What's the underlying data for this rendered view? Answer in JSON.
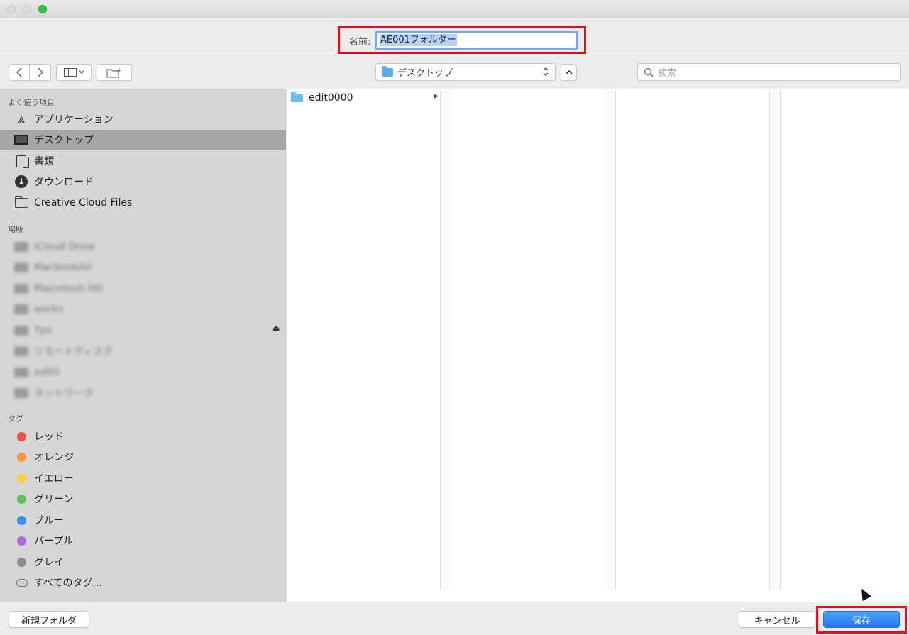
{
  "window": {
    "traffic_lights": [
      "close",
      "minimize",
      "zoom"
    ]
  },
  "name_row": {
    "label": "名前:",
    "value": "AE001フォルダー"
  },
  "toolbar": {
    "back_icon": "chevron-left-icon",
    "forward_icon": "chevron-right-icon",
    "view_icon": "column-view-icon",
    "new_folder_icon": "new-folder-icon",
    "location": "デスクトップ",
    "search_placeholder": "検索"
  },
  "sidebar": {
    "favorites_header": "よく使う項目",
    "favorites": [
      {
        "label": "アプリケーション",
        "icon": "applications-icon"
      },
      {
        "label": "デスクトップ",
        "icon": "desktop-icon",
        "selected": true
      },
      {
        "label": "書類",
        "icon": "documents-icon"
      },
      {
        "label": "ダウンロード",
        "icon": "downloads-icon"
      },
      {
        "label": "Creative Cloud Files",
        "icon": "folder-icon"
      }
    ],
    "locations_header": "場所",
    "locations": [
      {
        "label": "iCloud Drive"
      },
      {
        "label": "MacbookAir"
      },
      {
        "label": "Macintosh HD"
      },
      {
        "label": "works"
      },
      {
        "label": "Tps",
        "eject": true
      },
      {
        "label": "リモートディスク"
      },
      {
        "label": "edit0"
      },
      {
        "label": "ネットワーク"
      }
    ],
    "tags_header": "タグ",
    "tags": [
      {
        "label": "レッド",
        "color": "#f0504a"
      },
      {
        "label": "オレンジ",
        "color": "#f79a35"
      },
      {
        "label": "イエロー",
        "color": "#f8cf3c"
      },
      {
        "label": "グリーン",
        "color": "#5ec25a"
      },
      {
        "label": "ブルー",
        "color": "#3f8cf2"
      },
      {
        "label": "パープル",
        "color": "#b06ad6"
      },
      {
        "label": "グレイ",
        "color": "#8f8f8f"
      }
    ],
    "all_tags": "すべてのタグ..."
  },
  "browser": {
    "items": [
      {
        "name": "edit0000",
        "type": "folder"
      }
    ]
  },
  "bottom": {
    "new_folder": "新規フォルダ",
    "cancel": "キャンセル",
    "save": "保存"
  },
  "colors": {
    "highlight_box": "#e0101a",
    "save_button": "#1f79f2",
    "selected_sidebar": "#a6a6a6"
  }
}
